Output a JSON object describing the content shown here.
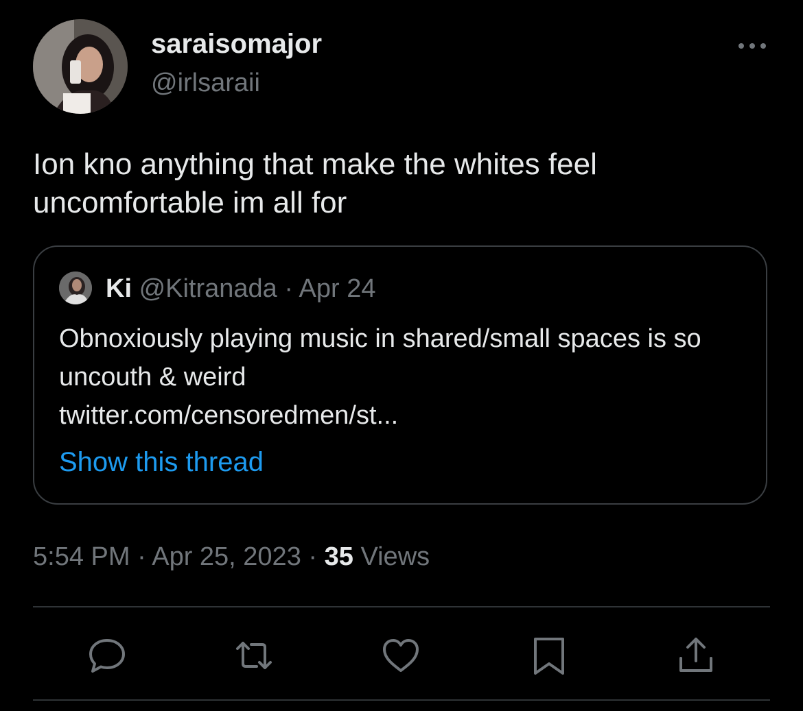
{
  "author": {
    "display_name": "saraisomajor",
    "handle": "@irlsaraii",
    "avatar_icon": "user-avatar-photo"
  },
  "tweet": {
    "text": "Ion kno anything that make the whites feel uncomfortable im all for"
  },
  "quoted_tweet": {
    "display_name": "Ki",
    "handle": "@Kitranada",
    "separator": "·",
    "date": "Apr 24",
    "text": "Obnoxiously playing music in shared/small spaces is so uncouth & weird",
    "link": "twitter.com/censoredmen/st...",
    "show_thread_label": "Show this thread"
  },
  "meta": {
    "time": "5:54 PM",
    "separator": "·",
    "date": "Apr 25, 2023",
    "views_count": "35",
    "views_label": "Views"
  },
  "actions": {
    "icons": [
      "reply-icon",
      "retweet-icon",
      "like-icon",
      "bookmark-icon",
      "share-icon"
    ]
  },
  "colors": {
    "background": "#000000",
    "primary_text": "#e7e9ea",
    "secondary_text": "#71767b",
    "accent": "#1d9bf0",
    "border": "#2f3336"
  }
}
